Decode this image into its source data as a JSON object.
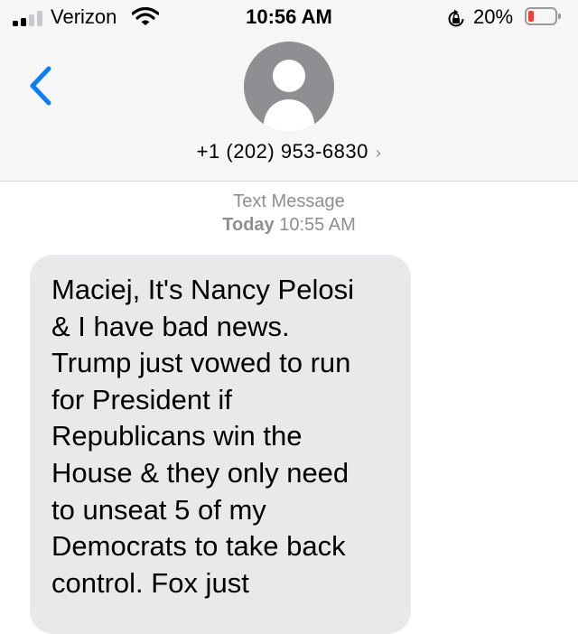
{
  "status_bar": {
    "carrier": "Verizon",
    "time": "10:56 AM",
    "battery_percent": "20%",
    "battery_level": 0.2,
    "signal_bars": 2,
    "signal_bars_total": 4
  },
  "header": {
    "back_icon": "chevron-left-icon",
    "contact": "+1 (202) 953-6830",
    "contact_chevron": "›"
  },
  "thread": {
    "service": "Text Message",
    "day": "Today",
    "time": "10:55 AM",
    "message": "Maciej, It's Nancy Pelosi\n& I have bad news.\nTrump just vowed to run\nfor President if\nRepublicans win the\nHouse & they only need\nto unseat 5 of my\nDemocrats to take back\ncontrol. Fox just"
  },
  "colors": {
    "accent": "#0a7cff",
    "bubble": "#e9e9eb",
    "meta_text": "#8e8e93",
    "battery_low": "#ff3b30",
    "header_bg": "#f6f6f6"
  }
}
